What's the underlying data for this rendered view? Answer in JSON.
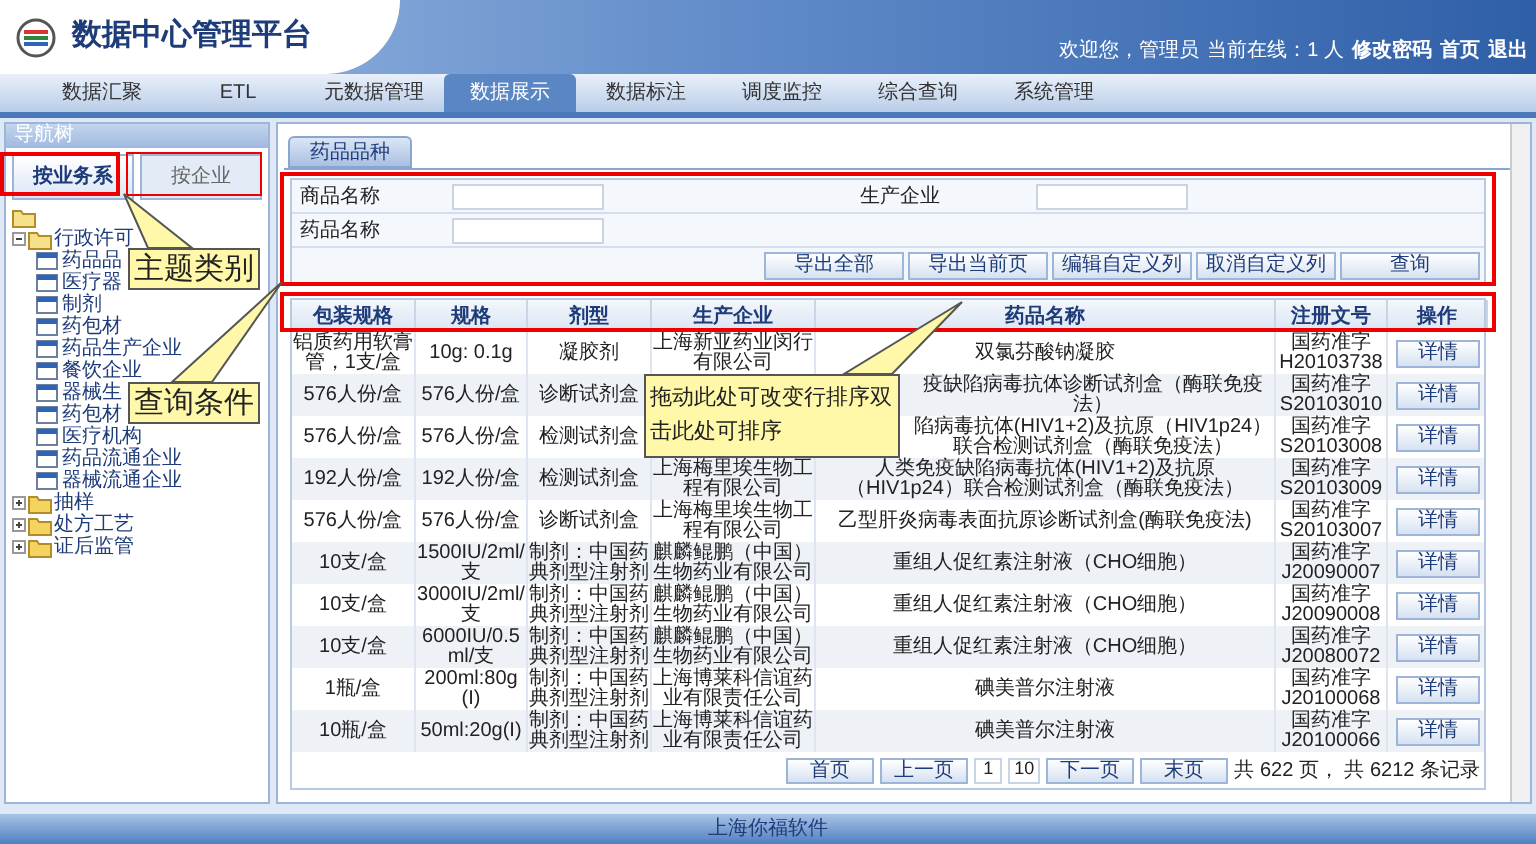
{
  "header": {
    "title": "数据中心管理平台",
    "welcome": "欢迎您，管理员",
    "online": "当前在线：1 人",
    "links": [
      "修改密码",
      "首页",
      "退出"
    ]
  },
  "nav": [
    {
      "label": "数据汇聚",
      "selected": false
    },
    {
      "label": "ETL",
      "selected": false
    },
    {
      "label": "元数据管理",
      "selected": false
    },
    {
      "label": "数据展示",
      "selected": true
    },
    {
      "label": "数据标注",
      "selected": false
    },
    {
      "label": "调度监控",
      "selected": false
    },
    {
      "label": "综合查询",
      "selected": false
    },
    {
      "label": "系统管理",
      "selected": false
    }
  ],
  "sidebar": {
    "title": "导航树",
    "tabs": [
      {
        "label": "按业务系",
        "selected": true
      },
      {
        "label": "按企业",
        "selected": false
      }
    ],
    "tree": [
      {
        "label": "行政许可",
        "expanded": true,
        "children": [
          {
            "label": "药品品"
          },
          {
            "label": "医疗器"
          },
          {
            "label": "制剂"
          },
          {
            "label": "药包材"
          },
          {
            "label": "药品生产企业"
          },
          {
            "label": "餐饮企业"
          },
          {
            "label": "器械生"
          },
          {
            "label": "药包材"
          },
          {
            "label": "医疗机构"
          },
          {
            "label": "药品流通企业"
          },
          {
            "label": "器械流通企业"
          }
        ]
      },
      {
        "label": "抽样",
        "expanded": false
      },
      {
        "label": "处方工艺",
        "expanded": false
      },
      {
        "label": "证后监管",
        "expanded": false
      }
    ]
  },
  "main": {
    "tab": "药品品种",
    "form": {
      "fields": [
        {
          "label": "商品名称"
        },
        {
          "label": "生产企业"
        },
        {
          "label": "药品名称"
        }
      ],
      "buttons": [
        "导出全部",
        "导出当前页",
        "编辑自定义列",
        "取消自定义列",
        "查询"
      ]
    },
    "table": {
      "columns": [
        "包装规格",
        "规格",
        "剂型",
        "生产企业",
        "药品名称",
        "注册文号",
        "操作"
      ],
      "rows": [
        {
          "package": "铝质药用软膏管，1支/盒",
          "spec": "10g: 0.1g",
          "form": "凝胶剂",
          "company": "上海新亚药业闵行有限公司",
          "name": "双氯芬酸钠凝胶",
          "approval": "国药准字H20103738",
          "action": "详情"
        },
        {
          "package": "576人份/盒",
          "spec": "576人份/盒",
          "form": "诊断试剂盒",
          "name": "疫缺陷病毒抗体诊断试剂盒（酶联免疫法）",
          "approval": "国药准字S20103010",
          "action": "详情"
        },
        {
          "package": "576人份/盒",
          "spec": "576人份/盒",
          "form": "检测试剂盒",
          "name": "陷病毒抗体(HIV1+2)及抗原（HIV1p24）联合检测试剂盒（酶联免疫法）",
          "approval": "国药准字S20103008",
          "action": "详情"
        },
        {
          "package": "192人份/盒",
          "spec": "192人份/盒",
          "form": "检测试剂盒",
          "company": "上海梅里埃生物工程有限公司",
          "name": "人类免疫缺陷病毒抗体(HIV1+2)及抗原（HIV1p24）联合检测试剂盒（酶联免疫法）",
          "approval": "国药准字S20103009",
          "action": "详情"
        },
        {
          "package": "576人份/盒",
          "spec": "576人份/盒",
          "form": "诊断试剂盒",
          "company": "上海梅里埃生物工程有限公司",
          "name": "乙型肝炎病毒表面抗原诊断试剂盒(酶联免疫法)",
          "approval": "国药准字S20103007",
          "action": "详情"
        },
        {
          "package": "10支/盒",
          "spec": "1500IU/2ml/支",
          "form": "制剂：中国药典剂型注射剂",
          "company": "麒麟鲲鹏（中国）生物药业有限公司",
          "name": "重组人促红素注射液（CHO细胞）",
          "approval": "国药准字J20090007",
          "action": "详情"
        },
        {
          "package": "10支/盒",
          "spec": "3000IU/2ml/支",
          "form": "制剂：中国药典剂型注射剂",
          "company": "麒麟鲲鹏（中国）生物药业有限公司",
          "name": "重组人促红素注射液（CHO细胞）",
          "approval": "国药准字J20090008",
          "action": "详情"
        },
        {
          "package": "10支/盒",
          "spec": "6000IU/0.5ml/支",
          "form": "制剂：中国药典剂型注射剂",
          "company": "麒麟鲲鹏（中国）生物药业有限公司",
          "name": "重组人促红素注射液（CHO细胞）",
          "approval": "国药准字J20080072",
          "action": "详情"
        },
        {
          "package": "1瓶/盒",
          "spec": "200ml:80g(I)",
          "form": "制剂：中国药典剂型注射剂",
          "company": "上海博莱科信谊药业有限责任公司",
          "name": "碘美普尔注射液",
          "approval": "国药准字J20100068",
          "action": "详情"
        },
        {
          "package": "10瓶/盒",
          "spec": "50ml:20g(I)",
          "form": "制剂：中国药典剂型注射剂",
          "company": "上海博莱科信谊药业有限责任公司",
          "name": "碘美普尔注射液",
          "approval": "国药准字J20100066",
          "action": "详情"
        }
      ]
    },
    "pager": {
      "buttons": [
        "首页",
        "上一页",
        "下一页",
        "末页"
      ],
      "page": "1",
      "size": "10",
      "summary": "共 622 页， 共 6212 条记录"
    }
  },
  "callouts": [
    {
      "text": "主题类别"
    },
    {
      "text": "查询条件"
    },
    {
      "text": "拖动此处可改变行排序双击此处可排序"
    }
  ],
  "footer": "上海你福软件"
}
